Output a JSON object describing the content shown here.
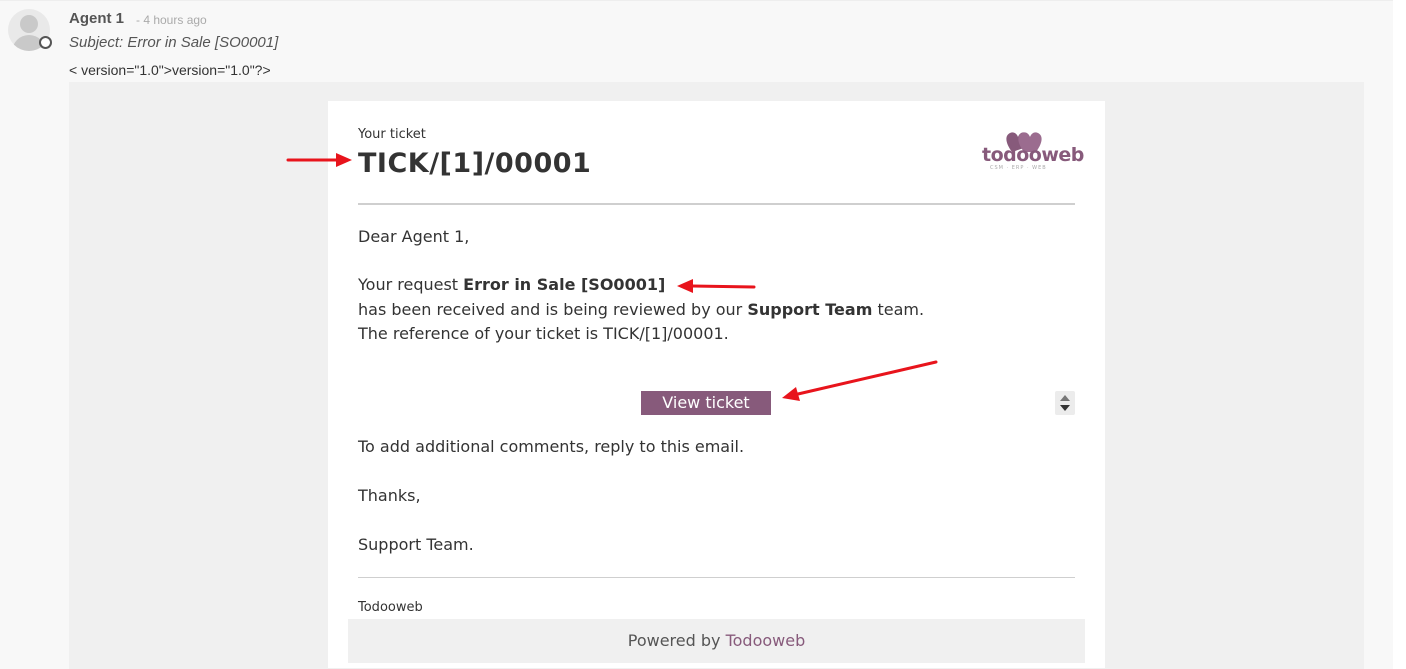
{
  "message": {
    "author": "Agent 1",
    "time": "- 4 hours ago",
    "subject": "Subject: Error in Sale [SO0001]",
    "xml_line": "< version=\"1.0\">version=\"1.0\"?>"
  },
  "email": {
    "header_label": "Your ticket",
    "ticket_ref": "TICK/[1]/00001",
    "logo": {
      "text": "todooweb",
      "tagline": "CSM · ERP · WEB",
      "icon": "todooweb-hearts-logo"
    },
    "greeting": "Dear Agent 1,",
    "request_prefix": "Your request ",
    "request_name": "Error in Sale [SO0001]",
    "received_prefix": "has been received and is being reviewed by our ",
    "team_name": "Support Team",
    "received_suffix": " team.",
    "reference_line": "The reference of your ticket is TICK/[1]/00001.",
    "view_button": "View ticket",
    "comments_line": "To add additional comments, reply to this email.",
    "thanks": "Thanks,",
    "signature": "Support Team.",
    "company": "Todooweb",
    "powered_prefix": "Powered by ",
    "powered_link": "Todooweb"
  },
  "colors": {
    "brand": "#875a7b",
    "annotation_arrow": "#e8141c"
  }
}
